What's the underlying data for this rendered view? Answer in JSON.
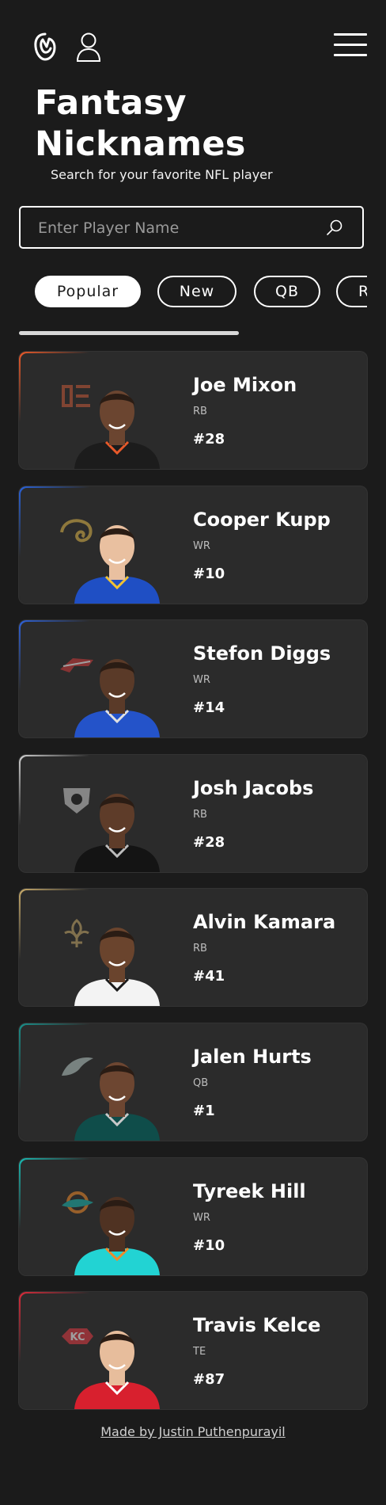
{
  "header": {
    "title_line1": "Fantasy",
    "title_line2": "Nicknames",
    "subtitle": "Search for your favorite NFL player"
  },
  "search": {
    "placeholder": "Enter Player Name",
    "value": ""
  },
  "tabs": [
    {
      "label": "Popular",
      "active": true
    },
    {
      "label": "New",
      "active": false
    },
    {
      "label": "QB",
      "active": false
    },
    {
      "label": "R",
      "active": false
    }
  ],
  "players": [
    {
      "name": "Joe Mixon",
      "position": "RB",
      "number": "#28",
      "team_icon": "bengals-logo-icon",
      "accent": "#e8592a",
      "jersey": "#1c1c1c",
      "trim": "#e8592a",
      "skin": "#6b4530"
    },
    {
      "name": "Cooper Kupp",
      "position": "WR",
      "number": "#10",
      "team_icon": "rams-logo-icon",
      "accent": "#2a62d8",
      "jersey": "#1f4fc4",
      "trim": "#f1c232",
      "skin": "#e9c0a0"
    },
    {
      "name": "Stefon Diggs",
      "position": "WR",
      "number": "#14",
      "team_icon": "bills-logo-icon",
      "accent": "#2f61d6",
      "jersey": "#2453c9",
      "trim": "#e0e0e0",
      "skin": "#5a3a28"
    },
    {
      "name": "Josh Jacobs",
      "position": "RB",
      "number": "#28",
      "team_icon": "raiders-logo-icon",
      "accent": "#cfcfcf",
      "jersey": "#141414",
      "trim": "#bdbdbd",
      "skin": "#5e3c29"
    },
    {
      "name": "Alvin Kamara",
      "position": "RB",
      "number": "#41",
      "team_icon": "saints-logo-icon",
      "accent": "#c6a96a",
      "jersey": "#f3f3f3",
      "trim": "#1a1a1a",
      "skin": "#6a442d"
    },
    {
      "name": "Jalen Hurts",
      "position": "QB",
      "number": "#1",
      "team_icon": "eagles-logo-icon",
      "accent": "#1a8f8a",
      "jersey": "#0f4d4a",
      "trim": "#c9c9c9",
      "skin": "#6d4631"
    },
    {
      "name": "Tyreek Hill",
      "position": "WR",
      "number": "#10",
      "team_icon": "dolphins-logo-icon",
      "accent": "#1ab7b0",
      "jersey": "#22d3d3",
      "trim": "#f08a2a",
      "skin": "#4f3222"
    },
    {
      "name": "Travis Kelce",
      "position": "TE",
      "number": "#87",
      "team_icon": "chiefs-logo-icon",
      "accent": "#d82b3a",
      "jersey": "#d8202e",
      "trim": "#ffffff",
      "skin": "#e7bd9c"
    }
  ],
  "footer": {
    "credit": "Made by Justin Puthenpurayil"
  }
}
